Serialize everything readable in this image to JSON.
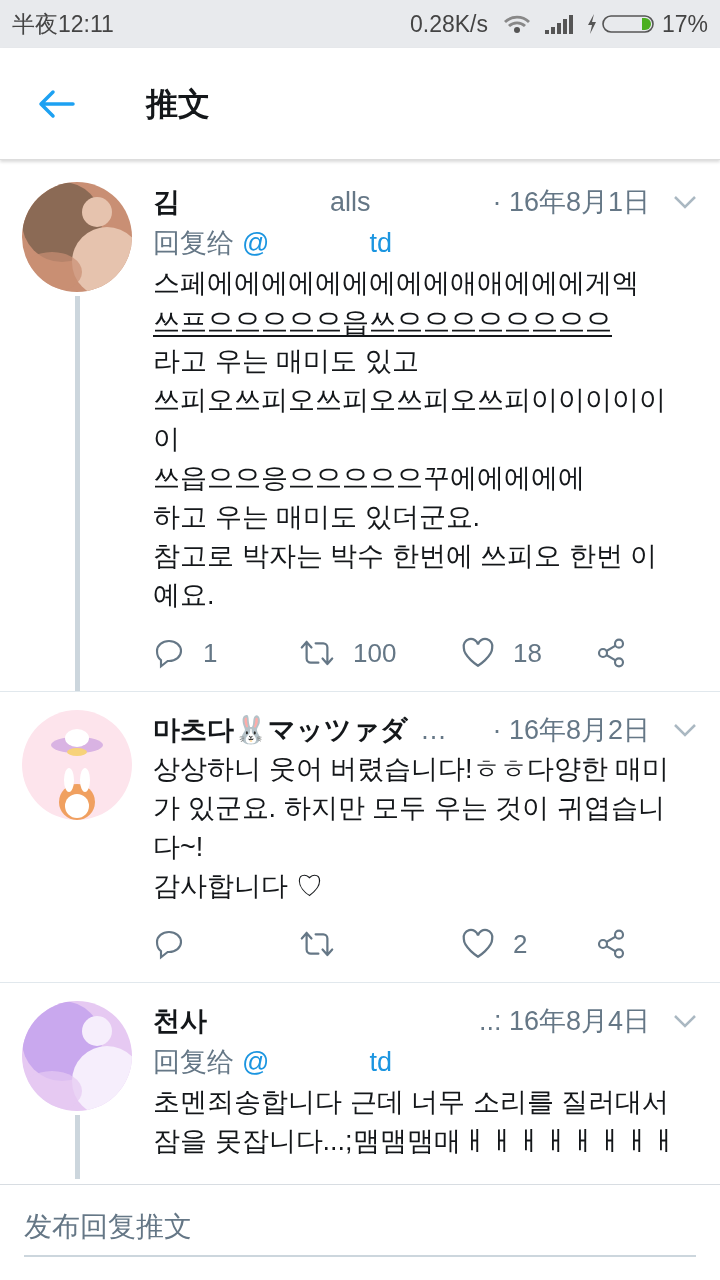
{
  "status_bar": {
    "time": "半夜12:11",
    "speed": "0.28K/s",
    "battery": "17%"
  },
  "header": {
    "title": "推文"
  },
  "tweets": [
    {
      "name": "김",
      "handle": "alls",
      "time": "· 16年8月1日",
      "reply_to": {
        "label": "回复给",
        "handle": "@",
        "handle_end": "td"
      },
      "thread_line": true,
      "lines": [
        {
          "text": "스페에에에에에에에에에애애에에에게엑",
          "underlined": false
        },
        {
          "text": "쓰프으으으으으읍쓰으으으으으으으으",
          "underlined": true
        },
        {
          "text": "라고 우는 매미도 있고",
          "underlined": false
        },
        {
          "text": "쓰피오쓰피오쓰피오쓰피오쓰피이이이이이",
          "underlined": false
        },
        {
          "text": "이",
          "underlined": false
        },
        {
          "text": "쓰읍으으응으으으으으꾸에에에에에",
          "underlined": false
        },
        {
          "text": "하고 우는 매미도 있더군요.",
          "underlined": false
        },
        {
          "text": "참고로 박자는 박수 한번에 쓰피오 한번 이",
          "underlined": false
        },
        {
          "text": "예요.",
          "underlined": false
        }
      ],
      "actions": {
        "replies": "1",
        "retweets": "100",
        "likes": "18"
      }
    },
    {
      "name": "마츠다🐰マッツァダ",
      "ellipsis": "…",
      "time": "· 16年8月2日",
      "thread_line": false,
      "lines": [
        {
          "text": "상상하니 웃어 버렸습니다!ㅎㅎ다양한 매미",
          "underlined": false
        },
        {
          "text": "가 있군요. 하지만 모두 우는 것이 귀엽습니",
          "underlined": false
        },
        {
          "text": "다~!",
          "underlined": false
        },
        {
          "text": "감사합니다 ♡",
          "underlined": false
        }
      ],
      "actions": {
        "likes": "2"
      }
    },
    {
      "name": "천사",
      "time": "..: 16年8月4日",
      "reply_to": {
        "label": "回复给",
        "handle": "@",
        "handle_end": "td"
      },
      "thread_line": true,
      "lines": [
        {
          "text": "초멘죄송합니다 근데 너무 소리를 질러대서",
          "underlined": false
        },
        {
          "text": "잠을 못잡니다...;맴맴맴매ㅐㅐㅐㅐㅐㅐㅐㅐ",
          "underlined": false
        }
      ]
    }
  ],
  "compose": {
    "placeholder": "发布回复推文"
  }
}
